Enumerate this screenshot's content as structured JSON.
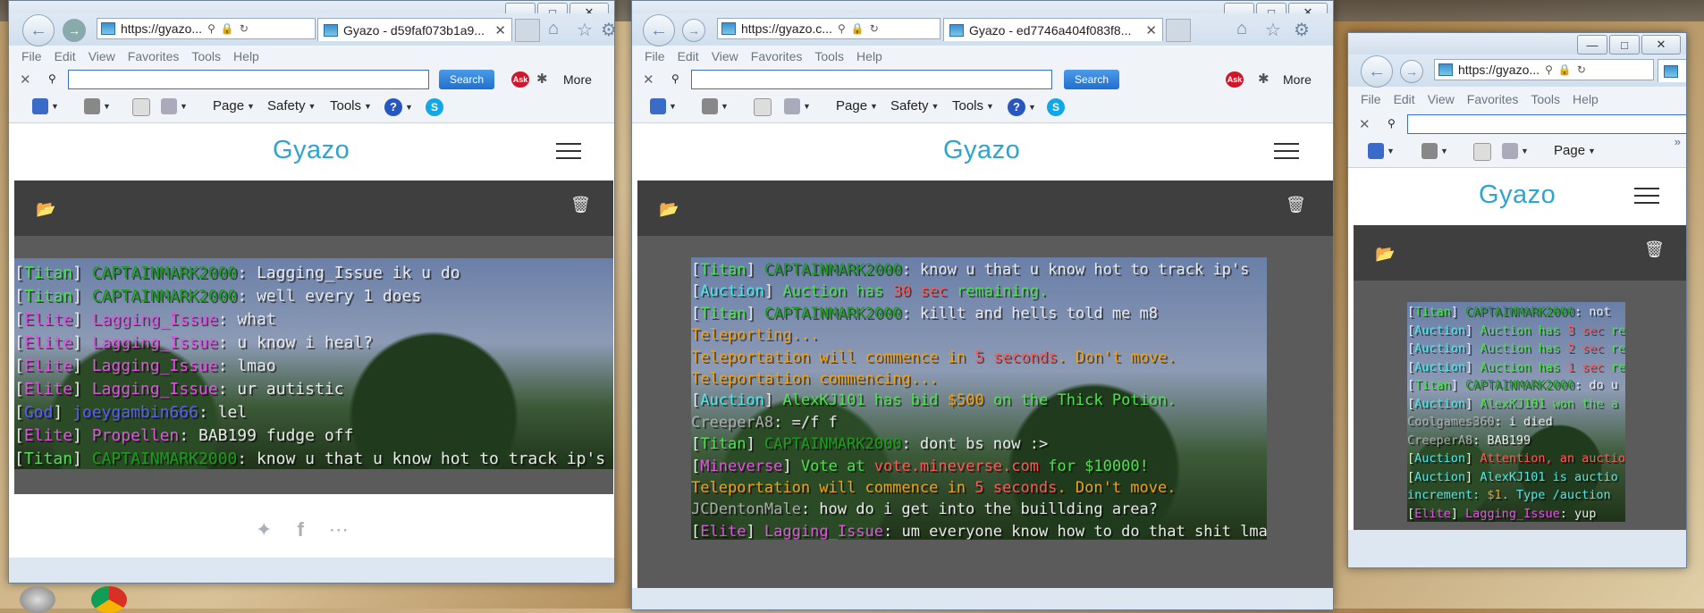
{
  "menu": [
    "File",
    "Edit",
    "View",
    "Favorites",
    "Tools",
    "Help"
  ],
  "search_label": "Search",
  "more_label": "More",
  "cmd": {
    "page": "Page",
    "safety": "Safety",
    "tools": "Tools"
  },
  "logo": "Gyazo",
  "windows": [
    {
      "address": "https://gyazo...",
      "tab_title": "Gyazo - d59faf073b1a9...",
      "chat": [
        [
          [
            "[",
            "w"
          ],
          [
            "Titan",
            "g"
          ],
          [
            "] ",
            "w"
          ],
          [
            "CAPTAINMARK2000",
            "dg"
          ],
          [
            ": Lagging_Issue ik u do",
            "w"
          ]
        ],
        [
          [
            "[",
            "w"
          ],
          [
            "Titan",
            "g"
          ],
          [
            "] ",
            "w"
          ],
          [
            "CAPTAINMARK2000",
            "dg"
          ],
          [
            ": well every 1 does",
            "w"
          ]
        ],
        [
          [
            "[",
            "w"
          ],
          [
            "Elite",
            "p"
          ],
          [
            "] ",
            "w"
          ],
          [
            "Lagging_Issue",
            "p"
          ],
          [
            ": what",
            "w"
          ]
        ],
        [
          [
            "[",
            "w"
          ],
          [
            "Elite",
            "p"
          ],
          [
            "] ",
            "w"
          ],
          [
            "Lagging_Issue",
            "p"
          ],
          [
            ": u know i heal?",
            "w"
          ]
        ],
        [
          [
            "[",
            "w"
          ],
          [
            "Elite",
            "p"
          ],
          [
            "] ",
            "w"
          ],
          [
            "Lagging_Issue",
            "p"
          ],
          [
            ": lmao",
            "w"
          ]
        ],
        [
          [
            "[",
            "w"
          ],
          [
            "Elite",
            "p"
          ],
          [
            "] ",
            "w"
          ],
          [
            "Lagging_Issue",
            "p"
          ],
          [
            ": ur autistic",
            "w"
          ]
        ],
        [
          [
            "[",
            "w"
          ],
          [
            "God",
            "b"
          ],
          [
            "] ",
            "w"
          ],
          [
            "joeygambin666",
            "b"
          ],
          [
            ": lel",
            "w"
          ]
        ],
        [
          [
            "[",
            "w"
          ],
          [
            "Elite",
            "p"
          ],
          [
            "] ",
            "w"
          ],
          [
            "Propellen",
            "p"
          ],
          [
            ": BAB199 fudge off",
            "w"
          ]
        ],
        [
          [
            "[",
            "w"
          ],
          [
            "Titan",
            "g"
          ],
          [
            "] ",
            "w"
          ],
          [
            "CAPTAINMARK2000",
            "dg"
          ],
          [
            ": know u that u know hot to track ip's",
            "w"
          ]
        ]
      ]
    },
    {
      "address": "https://gyazo.c...",
      "tab_title": "Gyazo - ed7746a404f083f8...",
      "chat": [
        [
          [
            "[",
            "w"
          ],
          [
            "Titan",
            "g"
          ],
          [
            "] ",
            "w"
          ],
          [
            "CAPTAINMARK2000",
            "dg"
          ],
          [
            ": know u that u know hot to track ip's",
            "w"
          ]
        ],
        [
          [
            "[",
            "w"
          ],
          [
            "Auction",
            "a"
          ],
          [
            "] ",
            "w"
          ],
          [
            "Auction has ",
            "g"
          ],
          [
            "30 sec",
            "r"
          ],
          [
            " remaining.",
            "g"
          ]
        ],
        [
          [
            "[",
            "w"
          ],
          [
            "Titan",
            "g"
          ],
          [
            "] ",
            "w"
          ],
          [
            "CAPTAINMARK2000",
            "dg"
          ],
          [
            ": killt and hells told me m8",
            "w"
          ]
        ],
        [
          [
            "Teleporting...",
            "o"
          ]
        ],
        [
          [
            "Teleportation will commence in ",
            "o"
          ],
          [
            "5 seconds",
            "r"
          ],
          [
            ". Don't move.",
            "o"
          ]
        ],
        [
          [
            "Teleportation commencing...",
            "o"
          ]
        ],
        [
          [
            "[",
            "w"
          ],
          [
            "Auction",
            "a"
          ],
          [
            "] ",
            "w"
          ],
          [
            "AlexKJ101 has bid ",
            "g"
          ],
          [
            "$500",
            "o"
          ],
          [
            " on the Thick Potion.",
            "g"
          ]
        ],
        [
          [
            "CreeperA8",
            "gr"
          ],
          [
            ": =/f f",
            "w"
          ]
        ],
        [
          [
            "[",
            "w"
          ],
          [
            "Titan",
            "g"
          ],
          [
            "] ",
            "w"
          ],
          [
            "CAPTAINMARK2000",
            "dg"
          ],
          [
            ": dont bs now :>",
            "w"
          ]
        ],
        [
          [
            "[",
            "w"
          ],
          [
            "Mineverse",
            "p"
          ],
          [
            "] ",
            "w"
          ],
          [
            "Vote at ",
            "g"
          ],
          [
            "vote.mineverse.com",
            "r"
          ],
          [
            " for $10000!",
            "g"
          ]
        ],
        [
          [
            "Teleportation will commence in ",
            "o"
          ],
          [
            "5 seconds",
            "r"
          ],
          [
            ". Don't move.",
            "o"
          ]
        ],
        [
          [
            "JCDentonMale",
            "gr"
          ],
          [
            ": how do i get into the buillding area?",
            "w"
          ]
        ],
        [
          [
            "[",
            "w"
          ],
          [
            "Elite",
            "p"
          ],
          [
            "] ",
            "w"
          ],
          [
            "Lagging_Issue",
            "p"
          ],
          [
            ": um everyone know how to do that shit lmao",
            "w"
          ]
        ]
      ]
    },
    {
      "address": "https://gyazo...",
      "chat": [
        [
          [
            "[",
            "w"
          ],
          [
            "Titan",
            "g"
          ],
          [
            "] ",
            "w"
          ],
          [
            "CAPTAINMARK2000",
            "dg"
          ],
          [
            ": not",
            "w"
          ]
        ],
        [
          [
            "[",
            "w"
          ],
          [
            "Auction",
            "a"
          ],
          [
            "] ",
            "w"
          ],
          [
            "Auction has ",
            "g"
          ],
          [
            "3 sec",
            "r"
          ],
          [
            " re",
            "g"
          ]
        ],
        [
          [
            "[",
            "w"
          ],
          [
            "Auction",
            "a"
          ],
          [
            "] ",
            "w"
          ],
          [
            "Auction has ",
            "g"
          ],
          [
            "2 sec",
            "r"
          ],
          [
            " re",
            "g"
          ]
        ],
        [
          [
            "[",
            "w"
          ],
          [
            "Auction",
            "a"
          ],
          [
            "] ",
            "w"
          ],
          [
            "Auction has ",
            "g"
          ],
          [
            "1 sec",
            "r"
          ],
          [
            " re",
            "g"
          ]
        ],
        [
          [
            "[",
            "w"
          ],
          [
            "Titan",
            "g"
          ],
          [
            "] ",
            "w"
          ],
          [
            "CAPTAINMARK2000",
            "dg"
          ],
          [
            ": do u",
            "w"
          ]
        ],
        [
          [
            "[",
            "w"
          ],
          [
            "Auction",
            "a"
          ],
          [
            "] ",
            "w"
          ],
          [
            "AlexKJ101 won the a",
            "g"
          ]
        ],
        [
          [
            "Coolgames360",
            "gr"
          ],
          [
            ": i died",
            "w"
          ]
        ],
        [
          [
            "CreeperA8",
            "gr"
          ],
          [
            ": BAB199",
            "w"
          ]
        ],
        [
          [
            "[",
            "w"
          ],
          [
            "Auction",
            "a"
          ],
          [
            "] ",
            "w"
          ],
          [
            "Attention, an auctio",
            "r"
          ]
        ],
        [
          [
            "[",
            "w"
          ],
          [
            "Auction",
            "a"
          ],
          [
            "] ",
            "w"
          ],
          [
            "AlexKJ101 is auctio",
            "a"
          ]
        ],
        [
          [
            " increment: ",
            "a"
          ],
          [
            "$1",
            "o"
          ],
          [
            ". Type /auction",
            "a"
          ]
        ],
        [
          [
            "[",
            "w"
          ],
          [
            "Elite",
            "p"
          ],
          [
            "] ",
            "w"
          ],
          [
            "Lagging_Issue",
            "p"
          ],
          [
            ": yup",
            "w"
          ]
        ]
      ]
    }
  ],
  "colors": {
    "w": "#e8e8e8",
    "g": "#4de04d",
    "dg": "#1a9c1a",
    "p": "#e052e0",
    "b": "#5a5aff",
    "a": "#4ce6e6",
    "r": "#ff5555",
    "o": "#f0a015",
    "gr": "#aaaaaa",
    "gyazo": "#2ea4cf"
  }
}
